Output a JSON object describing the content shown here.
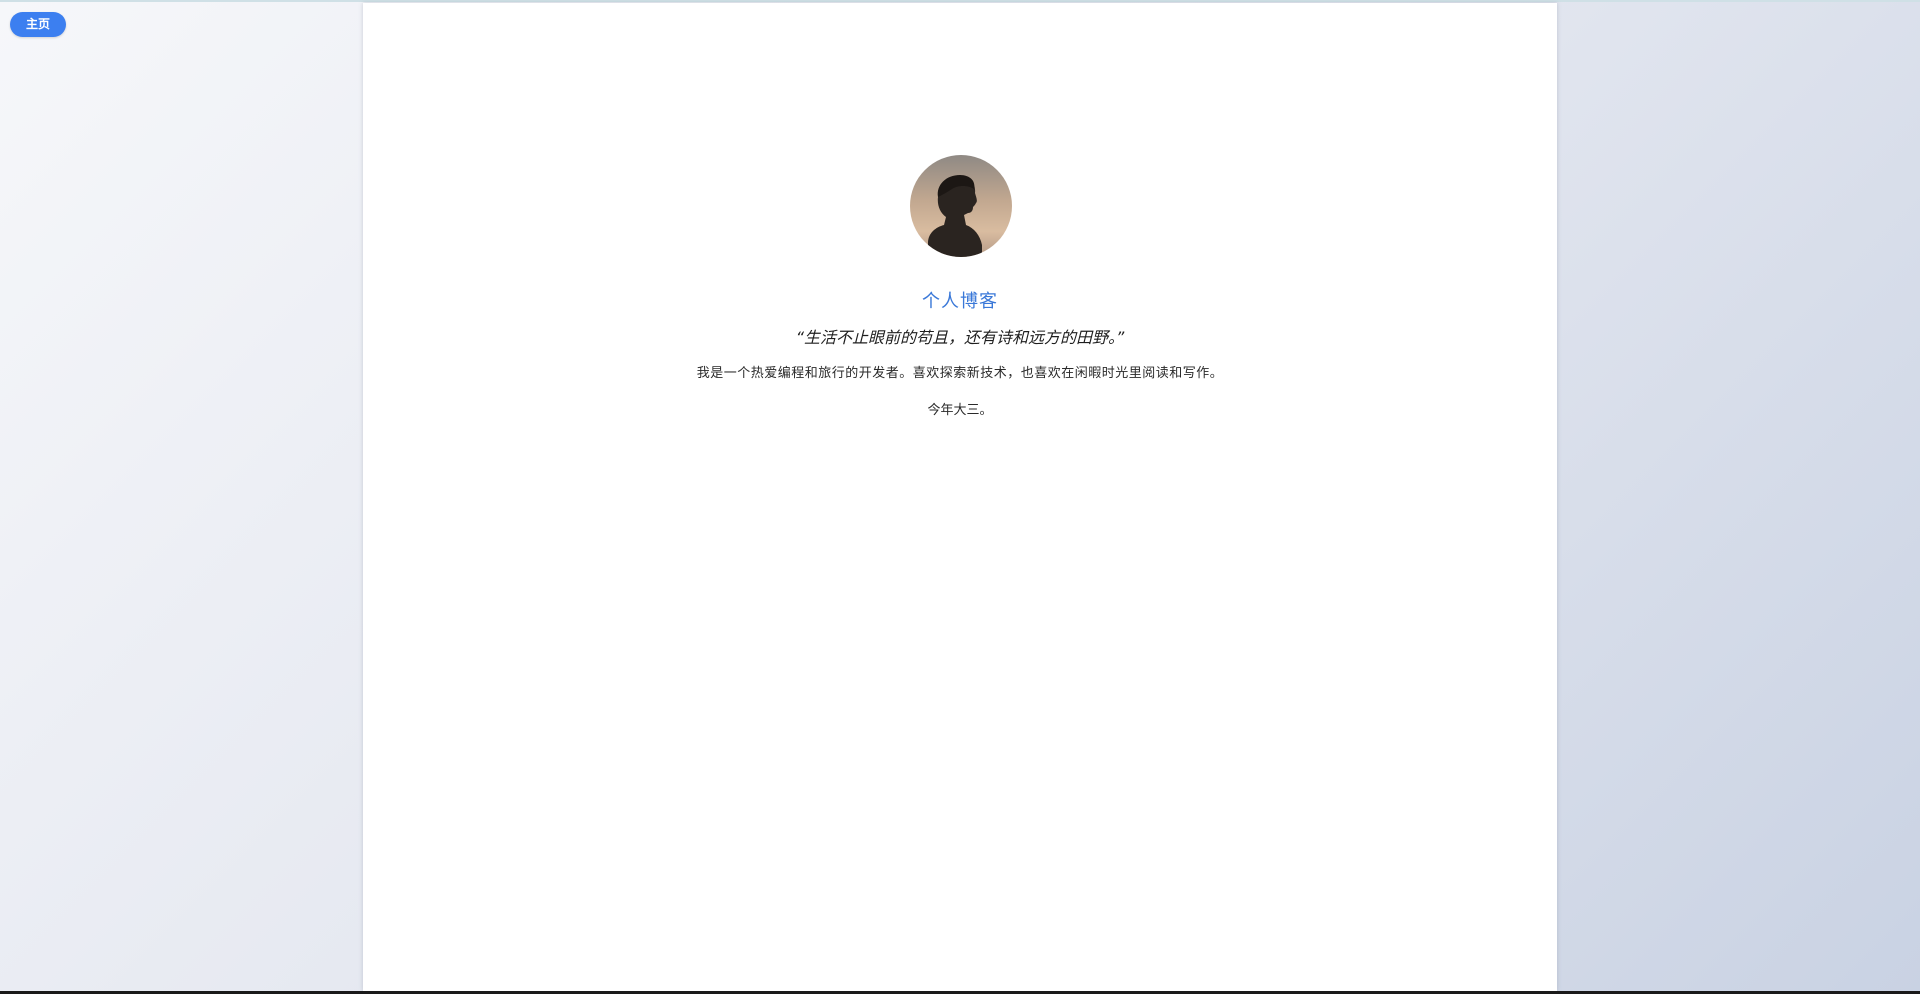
{
  "nav": {
    "home_label": "主页"
  },
  "profile": {
    "title": "个人博客",
    "quote": "“生活不止眼前的苟且，还有诗和远方的田野。”",
    "intro": "我是一个热爱编程和旅行的开发者。喜欢探索新技术，也喜欢在闲暇时光里阅读和写作。",
    "age": "今年大三。",
    "avatar_icon": "profile-silhouette-photo"
  },
  "colors": {
    "accent": "#3c7ff0",
    "title": "#3a78d8",
    "card": "#ffffff"
  }
}
